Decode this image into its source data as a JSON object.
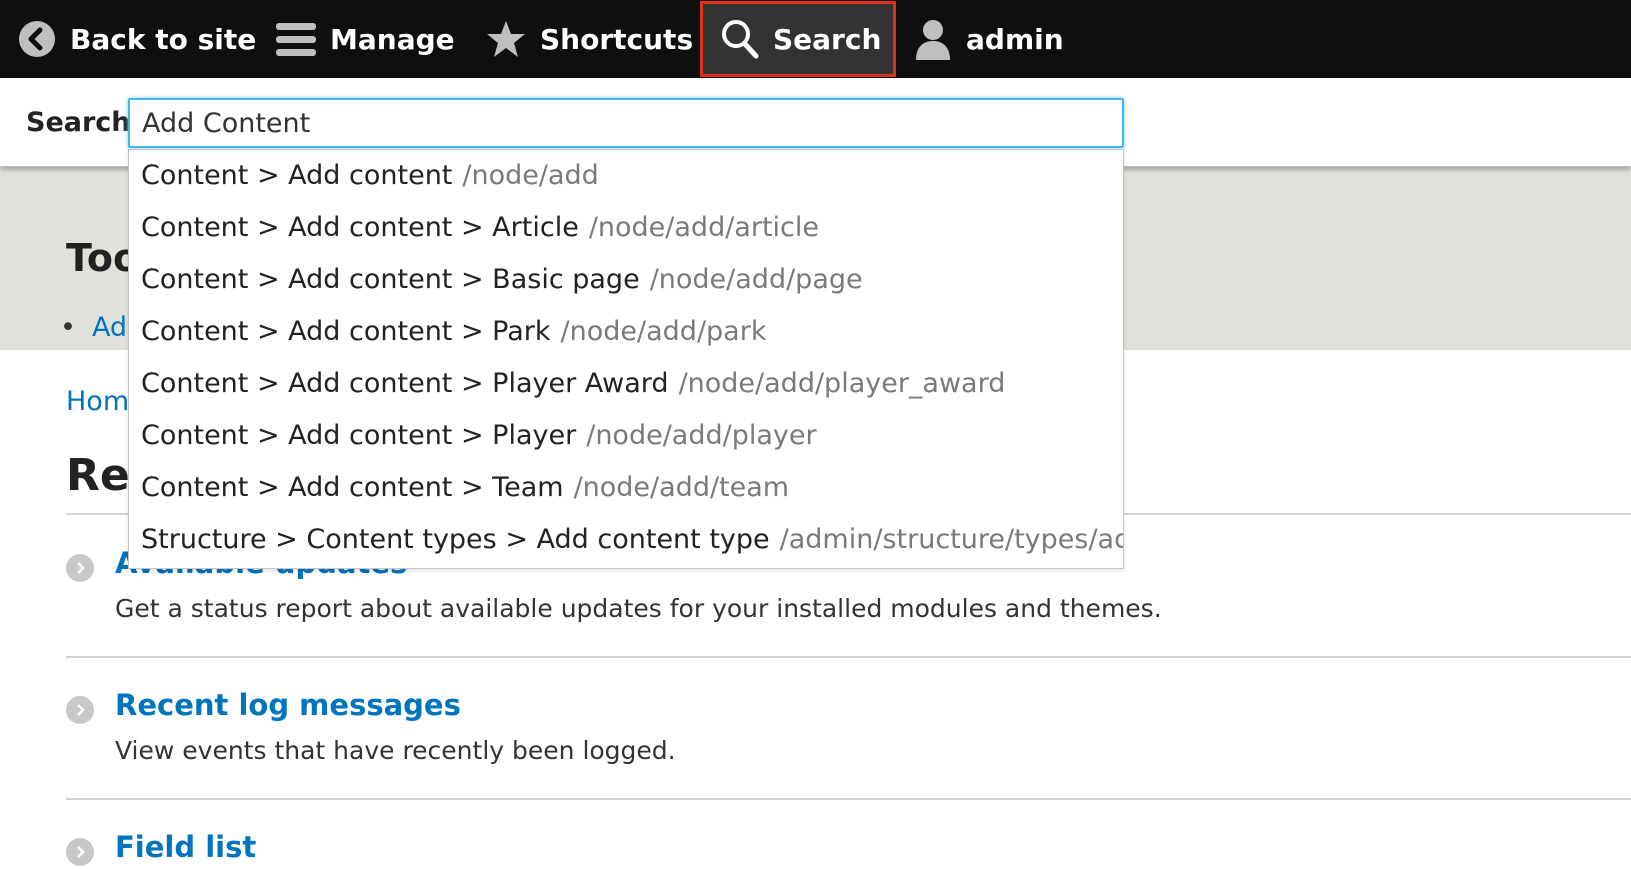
{
  "toolbar": {
    "back_label": "Back to site",
    "manage_label": "Manage",
    "shortcuts_label": "Shortcuts",
    "search_label": "Search",
    "user_label": "admin",
    "highlight_color": "#e12f1f"
  },
  "search_tray": {
    "label": "Search",
    "input_value": "Add Content"
  },
  "autocomplete": [
    {
      "label": "Content > Add content",
      "path": "/node/add"
    },
    {
      "label": "Content > Add content > Article",
      "path": "/node/add/article"
    },
    {
      "label": "Content > Add content > Basic page",
      "path": "/node/add/page"
    },
    {
      "label": "Content > Add content > Park",
      "path": "/node/add/park"
    },
    {
      "label": "Content > Add content > Player Award",
      "path": "/node/add/player_award"
    },
    {
      "label": "Content > Add content > Player",
      "path": "/node/add/player"
    },
    {
      "label": "Content > Add content > Team",
      "path": "/node/add/team"
    },
    {
      "label": "Structure > Content types > Add content type",
      "path": "/admin/structure/types/add"
    }
  ],
  "page": {
    "hero_title_partial": "Too",
    "hero_link_partial": "Ad",
    "breadcrumb_partial": "Hom",
    "title_partial": "Re",
    "reports": [
      {
        "title": "Available updates",
        "description": "Get a status report about available updates for your installed modules and themes."
      },
      {
        "title": "Recent log messages",
        "description": "View events that have recently been logged."
      },
      {
        "title": "Field list",
        "description": ""
      }
    ]
  },
  "colors": {
    "toolbar_bg": "#0f0f0f",
    "link": "#0074bd",
    "hero_bg": "#e1e1dc",
    "input_focus": "#40b6f3"
  }
}
